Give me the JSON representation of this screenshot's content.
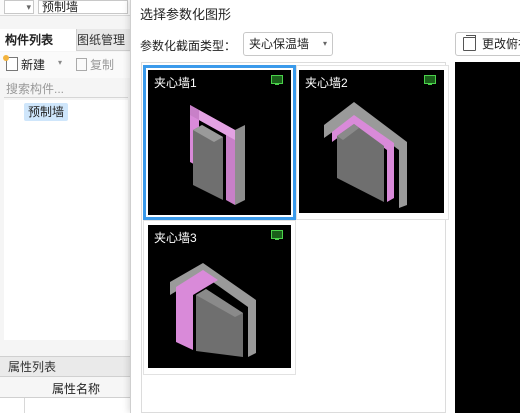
{
  "left_panel": {
    "current_type": "预制墙",
    "tabs": [
      {
        "label": "构件列表"
      },
      {
        "label": "图纸管理"
      }
    ],
    "toolbar": {
      "new_label": "新建",
      "copy_label": "复制"
    },
    "search_placeholder": "搜索构件...",
    "tree": {
      "selected_item": "预制墙"
    },
    "properties": {
      "title": "属性列表",
      "column_name": "属性名称"
    }
  },
  "dialog": {
    "title": "选择参数化图形",
    "type_label": "参数化截面类型：",
    "type_value": "夹心保温墙",
    "change_button_label": "更改俯视图",
    "options": [
      {
        "label": "夹心墙1",
        "selected": true
      },
      {
        "label": "夹心墙2",
        "selected": false
      },
      {
        "label": "夹心墙3",
        "selected": false
      }
    ]
  },
  "colors": {
    "selection_border": "#3a9aeb",
    "thumb_background": "#000000",
    "insulation_pink": "#d98ad9",
    "wall_gray": "#6f6f6f"
  }
}
